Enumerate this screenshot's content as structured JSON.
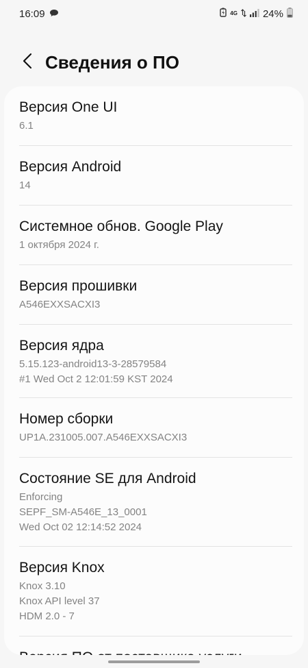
{
  "status_bar": {
    "time": "16:09",
    "network": "4G",
    "battery": "24%",
    "icons": [
      "chat-bubble-icon",
      "battery-saver-icon",
      "data-arrows-icon",
      "signal-icon",
      "battery-icon"
    ]
  },
  "header": {
    "back_icon": "chevron-left-icon",
    "title": "Сведения о ПО"
  },
  "items": [
    {
      "title": "Версия One UI",
      "lines": [
        "6.1"
      ]
    },
    {
      "title": "Версия Android",
      "lines": [
        "14"
      ]
    },
    {
      "title": "Системное обнов. Google Play",
      "lines": [
        "1 октября 2024 г."
      ]
    },
    {
      "title": "Версия прошивки",
      "lines": [
        "A546EXXSACXI3"
      ]
    },
    {
      "title": "Версия ядра",
      "lines": [
        "5.15.123-android13-3-28579584",
        "#1 Wed Oct 2 12:01:59 KST 2024"
      ]
    },
    {
      "title": "Номер сборки",
      "lines": [
        "UP1A.231005.007.A546EXXSACXI3"
      ]
    },
    {
      "title": "Состояние SE для Android",
      "lines": [
        "Enforcing",
        "SEPF_SM-A546E_13_0001",
        "Wed Oct 02 12:14:52 2024"
      ]
    },
    {
      "title": "Версия Knox",
      "lines": [
        "Knox 3.10",
        "Knox API level 37",
        "HDM 2.0 - 7"
      ]
    },
    {
      "title": "Версия ПО от поставщика услуги",
      "lines": []
    }
  ],
  "colors": {
    "background": "#f6f6f6",
    "card": "#fcfcfc",
    "title_text": "#141414",
    "value_text": "#838383",
    "divider": "#e3e3e3"
  }
}
